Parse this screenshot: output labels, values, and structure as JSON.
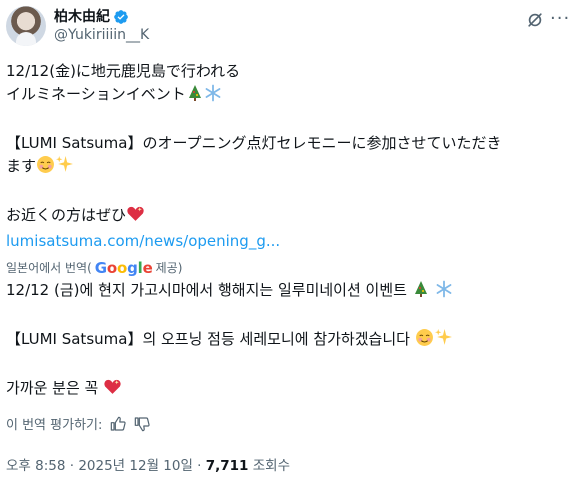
{
  "user": {
    "display_name": "柏木由紀",
    "handle": "@Yukiriiiin__K"
  },
  "tweet": {
    "original_lines": [
      "12/12(金)に地元鹿児島で行われる",
      "イルミネーションイベント",
      "",
      "【LUMI Satsuma】のオープニング点灯セレモニーに参加させていただき",
      "ます",
      "",
      "お近くの方はぜひ"
    ],
    "link_text": "lumisatsuma.com/news/opening_g...",
    "translated_from": "일본어에서 번역(",
    "translated_by": "제공)",
    "translation_lines": [
      "12/12 (금)에 현지 가고시마에서 행해지는 일루미네이션 이벤트",
      "",
      "【LUMI Satsuma】의 오프닝 점등 세레모니에 참가하겠습니다",
      "",
      "가까운 분은 꼭"
    ]
  },
  "rate_translation": "이 번역 평가하기:",
  "meta": {
    "time_date": "오후 8:58 · 2025년 12월 10일 · ",
    "views_count": "7,711",
    "views_label": " 조회수"
  },
  "icons": {
    "verified": "verified-badge-icon",
    "grok": "grok-icon",
    "more": "more-icon",
    "thumbs_up": "thumbs-up-icon",
    "thumbs_down": "thumbs-down-icon",
    "tree": "christmas-tree-emoji",
    "snowflake": "snowflake-emoji",
    "smile": "smiling-face-emoji",
    "sparkles": "sparkles-emoji",
    "heart": "sparkling-heart-emoji"
  },
  "colors": {
    "link": "#1d9bf0",
    "verified": "#1d9bf0",
    "secondary_text": "#536471"
  }
}
